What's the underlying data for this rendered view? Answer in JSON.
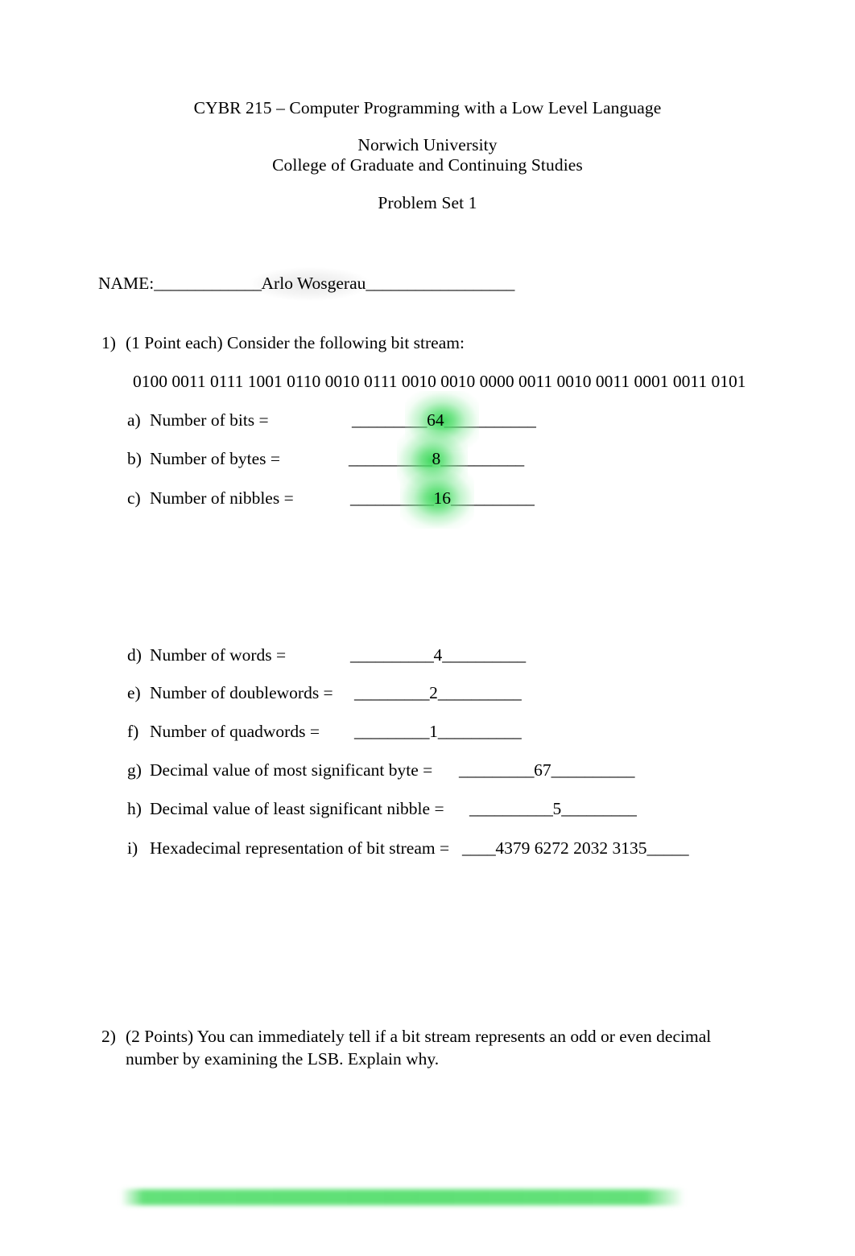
{
  "document": {
    "header": {
      "course_line": "CYBR 215 – Computer Programming with a Low Level Language",
      "university": "Norwich University",
      "college": "College of Graduate and Continuing Studies",
      "assignment": "Problem Set 1"
    },
    "name_field": {
      "label": "NAME:",
      "rule_before": "_____________",
      "value": "Arlo Wosgerau",
      "rule_after": "__________________"
    },
    "questions": [
      {
        "number": "1)",
        "text": "(1 Point each) Consider the following bit stream:",
        "bit_stream": "0100 0011 0111 1001 0110 0010 0111 0010 0010 0000 0011 0010 0011 0001 0011 0101",
        "items": [
          {
            "marker": "a)",
            "label": "Number of bits =",
            "rule_before": "_________",
            "value": "64",
            "rule_after": "___________",
            "highlight": "green"
          },
          {
            "marker": "b)",
            "label": "Number of bytes =",
            "rule_before": "__________",
            "value": "8",
            "rule_after": "__________",
            "highlight": "green"
          },
          {
            "marker": "c)",
            "label": "Number of nibbles =",
            "rule_before": "__________",
            "value": "16",
            "rule_after": "__________",
            "highlight": "green"
          },
          {
            "marker": "d)",
            "label": "Number of words =",
            "rule_before": "__________",
            "value": "4",
            "rule_after": "__________",
            "highlight": "none"
          },
          {
            "marker": "e)",
            "label": "Number of doublewords =",
            "rule_before": "_________",
            "value": "2",
            "rule_after": "__________",
            "highlight": "none"
          },
          {
            "marker": "f)",
            "label": "Number of quadwords =",
            "rule_before": "_________",
            "value": "1",
            "rule_after": "__________",
            "highlight": "none"
          },
          {
            "marker": "g)",
            "label": "Decimal value of most significant byte =",
            "rule_before": "_________",
            "value": "67",
            "rule_after": "__________",
            "highlight": "none"
          },
          {
            "marker": "h)",
            "label": "Decimal value of least significant nibble =",
            "rule_before": "__________",
            "value": "5",
            "rule_after": "_________",
            "highlight": "none"
          },
          {
            "marker": "i)",
            "label": "Hexadecimal representation of bit stream =",
            "rule_before": "____",
            "value": "4379 6272 2032 3135",
            "rule_after": "_____",
            "highlight": "none"
          }
        ]
      },
      {
        "number": "2)",
        "text": "(2 Points) You can immediately tell if a bit stream represents an odd or even decimal number by examining the LSB. Explain why.",
        "bit_stream": "",
        "items": []
      }
    ],
    "annotations": {
      "highlight_color": "#34d654",
      "name_highlight_color": "#9a9a9a"
    }
  }
}
